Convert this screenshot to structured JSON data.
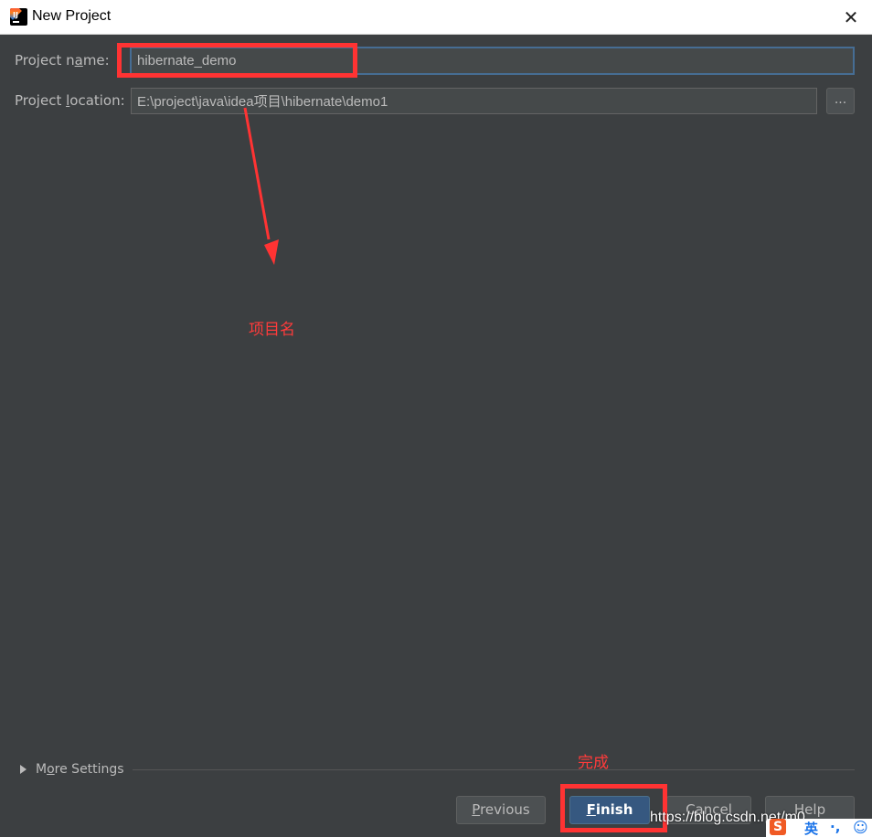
{
  "window": {
    "title": "New Project",
    "close_glyph": "✕",
    "icon": "intellij-idea-icon"
  },
  "form": {
    "name_label": {
      "pre": "Project n",
      "mnemonic": "a",
      "post": "me:"
    },
    "name_value": "hibernate_demo",
    "location_label": {
      "pre": "Project ",
      "mnemonic": "l",
      "post": "ocation:"
    },
    "location_value": "E:\\project\\java\\idea项目\\hibernate\\demo1",
    "browse_label": "..."
  },
  "annotations": {
    "name_note": "项目名",
    "finish_note": "完成",
    "color": "#ff3333"
  },
  "more_settings": {
    "pre": "M",
    "mnemonic": "o",
    "post": "re Settings"
  },
  "buttons": {
    "previous": {
      "mnemonic": "P",
      "rest": "revious"
    },
    "finish": {
      "mnemonic": "F",
      "rest": "inish"
    },
    "cancel": "Cancel",
    "help": "Help"
  },
  "watermark": "https://blog.csdn.net/m0_...",
  "ime": {
    "logo": "S",
    "lang": "英",
    "punc": "·,",
    "emoji": "☺"
  },
  "colors": {
    "background": "#3c3f41",
    "input_focus_border": "#466d94",
    "default_button": "#365880",
    "annotation_red": "#ff3333"
  }
}
